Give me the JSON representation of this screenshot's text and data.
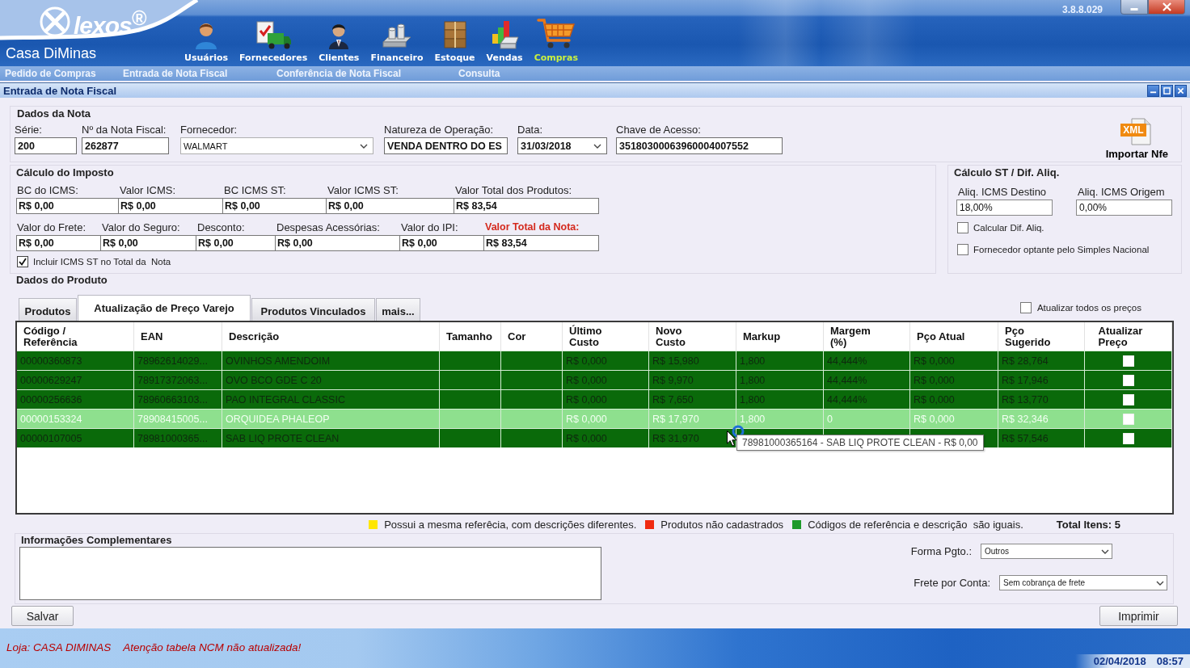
{
  "header": {
    "logo": "lexos$^{®}$",
    "company": "Casa DiMinas",
    "version": "3.8.8.029"
  },
  "nav": [
    {
      "label": "Usuários",
      "kind": "users",
      "selected": false
    },
    {
      "label": "Fornecedores",
      "kind": "suppliers",
      "selected": false
    },
    {
      "label": "Clientes",
      "kind": "clients",
      "selected": false
    },
    {
      "label": "Financeiro",
      "kind": "finance",
      "selected": false
    },
    {
      "label": "Estoque",
      "kind": "stock",
      "selected": false
    },
    {
      "label": "Vendas",
      "kind": "sales",
      "selected": false
    },
    {
      "label": "Compras",
      "kind": "purchases",
      "selected": true
    }
  ],
  "submenu": [
    "Pedido de Compras",
    "Entrada de Nota Fiscal",
    "Conferência de Nota Fiscal",
    "Consulta"
  ],
  "window": {
    "title": "Entrada de Nota Fiscal"
  },
  "dados_da_nota": {
    "title": "Dados da Nota",
    "fields": [
      {
        "label": "Série:",
        "value": "200",
        "kind": "text"
      },
      {
        "label": "Nº da Nota Fiscal:",
        "value": "262877",
        "kind": "text"
      },
      {
        "label": "Fornecedor:",
        "value": "WALMART",
        "kind": "select"
      },
      {
        "label": "Natureza de Operação:",
        "value": "VENDA DENTRO DO ES",
        "kind": "text"
      },
      {
        "label": "Data:",
        "value": "31/03/2018",
        "kind": "date"
      },
      {
        "label": "Chave de Acesso:",
        "value": "35180300063960004007552",
        "kind": "text"
      }
    ],
    "import_button": {
      "label": "Importar Nfe",
      "icon_text": "XML"
    }
  },
  "calculo_imposto": {
    "title": "Cálculo do Imposto",
    "rows": [
      {
        "fields": [
          {
            "label": "BC do ICMS:",
            "value": "R$ 0,00",
            "highlight": false
          },
          {
            "label": "Valor ICMS:",
            "value": "R$ 0,00",
            "highlight": false
          },
          {
            "label": "BC ICMS ST:",
            "value": "R$ 0,00",
            "highlight": false
          },
          {
            "label": "Valor ICMS ST:",
            "value": "R$ 0,00",
            "highlight": false
          },
          {
            "label": "Valor Total dos Produtos:",
            "value": "R$ 83,54",
            "highlight": false
          }
        ]
      },
      {
        "fields": [
          {
            "label": "Valor do Frete:",
            "value": "R$ 0,00",
            "highlight": false
          },
          {
            "label": "Valor do Seguro:",
            "value": "R$ 0,00",
            "highlight": false
          },
          {
            "label": "Desconto:",
            "value": "R$ 0,00",
            "highlight": false
          },
          {
            "label": "Despesas Acessórias:",
            "value": "R$ 0,00",
            "highlight": false
          },
          {
            "label": "Valor do IPI:",
            "value": "R$ 0,00",
            "highlight": false
          },
          {
            "label": "Valor Total da Nota:",
            "value": "R$ 83,54",
            "highlight": true
          }
        ]
      }
    ],
    "include_st": {
      "label": "Incluir ICMS ST no Total da  Nota",
      "checked": true
    }
  },
  "calculo_st": {
    "title": "Cálculo ST / Dif. Aliq.",
    "fields": [
      {
        "label": "Aliq. ICMS Destino",
        "value": "18,00%"
      },
      {
        "label": "Aliq. ICMS Origem",
        "value": "0,00%"
      }
    ],
    "options": [
      {
        "label": "Calcular Dif. Aliq.",
        "checked": false
      },
      {
        "label": "Fornecedor optante pelo Simples Nacional",
        "checked": false
      }
    ]
  },
  "dados_do_produto": {
    "title": "Dados do Produto",
    "tabs": [
      {
        "label": "Produtos",
        "selected": false
      },
      {
        "label": "Atualização de Preço Varejo",
        "selected": true
      },
      {
        "label": "Produtos Vinculados",
        "selected": false
      },
      {
        "label": "mais...",
        "selected": false
      }
    ],
    "update_all": {
      "label": "Atualizar todos os preços",
      "checked": false
    },
    "table": {
      "columns": [
        "Código / Referência",
        "EAN",
        "Descrição",
        "Tamanho",
        "Cor",
        "Último Custo",
        "Novo Custo",
        "Markup",
        "Margem (%)",
        "Pço Atual",
        "Pço Sugerido",
        "Atualizar Preço"
      ],
      "rows": [
        {
          "cells": [
            "00000360873",
            "78962614029...",
            "OVINHOS AMENDOIM",
            null,
            null,
            "R$ 0,000",
            "R$ 15,980",
            "1,800",
            "44,444%",
            "R$ 0,000",
            "R$ 28,764"
          ],
          "update": false,
          "selected": false
        },
        {
          "cells": [
            "00000629247",
            "78917372063...",
            "OVO BCO GDE C 20",
            null,
            null,
            "R$ 0,000",
            "R$ 9,970",
            "1,800",
            "44,444%",
            "R$ 0,000",
            "R$ 17,946"
          ],
          "update": false,
          "selected": false
        },
        {
          "cells": [
            "00000256636",
            "78960663103...",
            "PAO INTEGRAL CLASSIC",
            null,
            null,
            "R$ 0,000",
            "R$ 7,650",
            "1,800",
            "44,444%",
            "R$ 0,000",
            "R$ 13,770"
          ],
          "update": false,
          "selected": false
        },
        {
          "cells": [
            "00000153324",
            "78908415005...",
            "ORQUIDEA PHALEOP",
            null,
            null,
            "R$ 0,000",
            "R$ 17,970",
            "1,800",
            "0",
            "R$ 0,000",
            "R$ 32,346"
          ],
          "update": false,
          "selected": true
        },
        {
          "cells": [
            "00000107005",
            "78981000365...",
            "SAB LIQ PROTE CLEAN",
            null,
            null,
            "R$ 0,000",
            "R$ 31,970",
            null,
            null,
            null,
            "R$ 57,546"
          ],
          "update": false,
          "selected": false,
          "tooltip": "78981000365164 - SAB LIQ PROTE CLEAN - R$ 0,00"
        }
      ]
    },
    "legend": [
      {
        "color": "#ffe600",
        "label": "Possui a mesma referêcia, com descrições diferentes."
      },
      {
        "color": "#f02a10",
        "label": "Produtos não cadastrados"
      },
      {
        "color": "#1e9a2a",
        "label": "Códigos de referência e descrição  são iguais."
      }
    ],
    "total": "Total Itens: 5"
  },
  "informacoes": {
    "title": "Informações Complementares"
  },
  "pagamento": [
    {
      "label": "Forma Pgto.:",
      "value": "Outros"
    },
    {
      "label": "Frete por Conta:",
      "value": "Sem cobrança de frete"
    }
  ],
  "buttons": [
    "Salvar",
    "Imprimir"
  ],
  "status_bar": {
    "store": "Loja: CASA DIMINAS",
    "warning": "Atenção tabela NCM não atualizada!",
    "date": "02/04/2018",
    "time": "08:57"
  }
}
